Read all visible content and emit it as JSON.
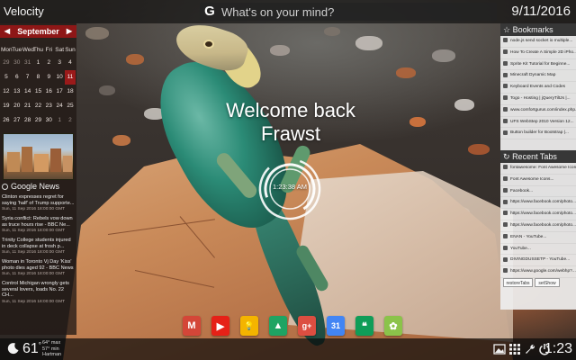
{
  "app_title": "Velocity",
  "date": "9/11/2016",
  "search": {
    "icon": "google-g-icon",
    "icon_label": "G",
    "placeholder": "What's on your mind?"
  },
  "calendar": {
    "month": "September",
    "prev_label": "◀",
    "next_label": "▶",
    "weekdays": [
      "Mon",
      "Tue",
      "Wed",
      "Thu",
      "Fri",
      "Sat",
      "Sun"
    ],
    "weeks": [
      [
        "29",
        "30",
        "31",
        "1",
        "2",
        "3",
        "4"
      ],
      [
        "5",
        "6",
        "7",
        "8",
        "9",
        "10",
        "11"
      ],
      [
        "12",
        "13",
        "14",
        "15",
        "16",
        "17",
        "18"
      ],
      [
        "19",
        "20",
        "21",
        "22",
        "23",
        "24",
        "25"
      ],
      [
        "26",
        "27",
        "28",
        "29",
        "30",
        "1",
        "2"
      ]
    ],
    "today": "11",
    "accent": "#8e1717"
  },
  "news": {
    "title": "Google News",
    "items": [
      {
        "headline": "Clinton expresses regret for saying 'half' of Trump supporte...",
        "meta": "Sun, 11 Sep 2016 18:00:00 GMT"
      },
      {
        "headline": "Syria conflict: Rebels vow down as truce hours rise - BBC Ne...",
        "meta": "Sun, 11 Sep 2016 18:00:00 GMT"
      },
      {
        "headline": "Trinity College students injured in deck collapse at frosh p...",
        "meta": "Sun, 11 Sep 2016 18:00:00 GMT"
      },
      {
        "headline": "Woman in Toronto Vj Day 'Kiss' photo dies aged 92 - BBC News",
        "meta": "Sun, 11 Sep 2016 18:00:00 GMT"
      },
      {
        "headline": "Control Michigan wrongly gets several lovers, loads No. 22 CH...",
        "meta": "Sun, 11 Sep 2016 18:00:00 GMT"
      }
    ]
  },
  "bookmarks": {
    "title": "Bookmarks",
    "items": [
      "node.js send socket io multiple...",
      "How To Create A Simple 2D iPho...",
      "Sprite Kit Tutorial for Beginne...",
      "Minecraft Dynamic Map",
      "Keyboard Events and Codes",
      "Togo - Hosting | jQueryTiltJs |...",
      "www.comfortgurus.com/index.php...",
      "UFS WebStep 2010 Version 12...",
      "Button builder for Bootstrap |..."
    ]
  },
  "recent_tabs": {
    "title": "Recent Tabs",
    "items": [
      "fontawesome: Font Awesome Icon...",
      "Font Awesome Icons...",
      "Facebook...",
      "https://www.facebook.com/photo...",
      "https://www.facebook.com/photo...",
      "https://www.facebook.com/photo...",
      "ENAN - YouTube...",
      "YouTube...",
      "DIVINGDUSSETP - YouTube...",
      "https://www.google.com/webhp?..."
    ]
  },
  "panel_buttons": {
    "restore": "restoreTabs",
    "hide": "setShow"
  },
  "welcome": {
    "text": "Welcome back Frawst"
  },
  "clock": {
    "time": "1:23:38 AM"
  },
  "dock_apps": [
    {
      "name": "gmail",
      "label": "M",
      "color": "#d44638"
    },
    {
      "name": "youtube",
      "label": "▶",
      "color": "#e62117"
    },
    {
      "name": "keep",
      "label": "💡",
      "color": "#f4b400"
    },
    {
      "name": "drive",
      "label": "▲",
      "color": "#1fa463"
    },
    {
      "name": "google-plus",
      "label": "g+",
      "color": "#dc4e41"
    },
    {
      "name": "calendar",
      "label": "31",
      "color": "#4285f4"
    },
    {
      "name": "hangouts",
      "label": "❝",
      "color": "#0f9d58"
    },
    {
      "name": "extra",
      "label": "✿",
      "color": "#8bc34a"
    }
  ],
  "weather": {
    "icon": "moon-icon",
    "temp": "61",
    "deg": "°",
    "max": "64° max",
    "min": "57° min",
    "location": "Hartman"
  },
  "bottom_icons": [
    "image-icon",
    "grid-icon",
    "wrench-icon",
    "power-icon"
  ],
  "time": "1:23"
}
